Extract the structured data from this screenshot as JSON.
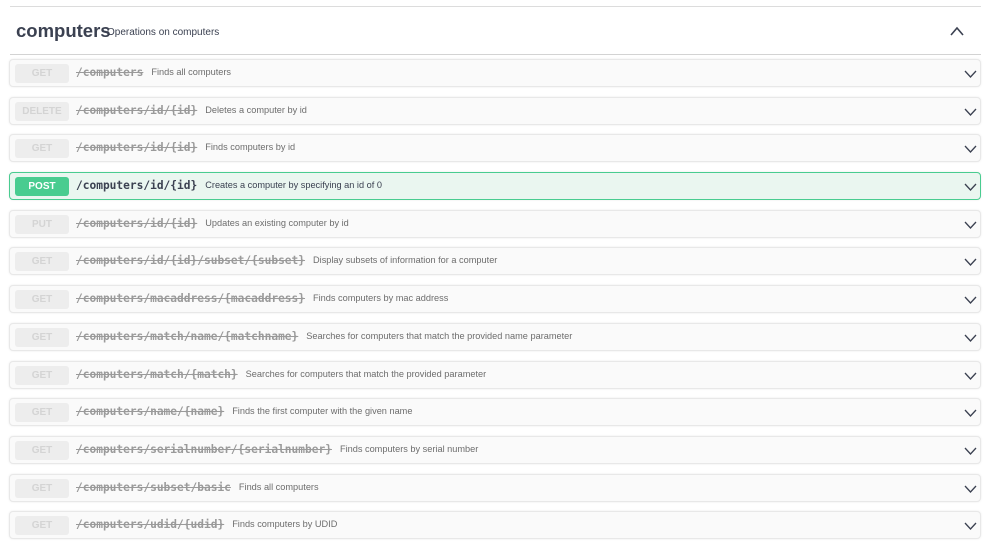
{
  "tag": {
    "name": "computers",
    "description": "Operations on computers",
    "toggle_icon": "chevron-up-icon"
  },
  "operations": [
    {
      "method": "GET",
      "path": "/computers",
      "summary": "Finds all computers",
      "active": false
    },
    {
      "method": "DELETE",
      "path": "/computers/id/{id}",
      "summary": "Deletes a computer by id",
      "active": false
    },
    {
      "method": "GET",
      "path": "/computers/id/{id}",
      "summary": "Finds computers by id",
      "active": false
    },
    {
      "method": "POST",
      "path": "/computers/id/{id}",
      "summary": "Creates a computer by specifying an id of 0",
      "active": true
    },
    {
      "method": "PUT",
      "path": "/computers/id/{id}",
      "summary": "Updates an existing computer by id",
      "active": false
    },
    {
      "method": "GET",
      "path": "/computers/id/{id}/subset/{subset}",
      "summary": "Display subsets of information for a computer",
      "active": false
    },
    {
      "method": "GET",
      "path": "/computers/macaddress/{macaddress}",
      "summary": "Finds computers by mac address",
      "active": false
    },
    {
      "method": "GET",
      "path": "/computers/match/name/{matchname}",
      "summary": "Searches for computers that match the provided name parameter",
      "active": false
    },
    {
      "method": "GET",
      "path": "/computers/match/{match}",
      "summary": "Searches for computers that match the provided parameter",
      "active": false
    },
    {
      "method": "GET",
      "path": "/computers/name/{name}",
      "summary": "Finds the first computer with the given name",
      "active": false
    },
    {
      "method": "GET",
      "path": "/computers/serialnumber/{serialnumber}",
      "summary": "Finds computers by serial number",
      "active": false
    },
    {
      "method": "GET",
      "path": "/computers/subset/basic",
      "summary": "Finds all computers",
      "active": false
    },
    {
      "method": "GET",
      "path": "/computers/udid/{udid}",
      "summary": "Finds computers by UDID",
      "active": false
    }
  ],
  "colors": {
    "post": "#49cc90",
    "post_bg": "#eaf6f0",
    "deprecated_badge": "#ededed",
    "text": "#3b4151"
  }
}
